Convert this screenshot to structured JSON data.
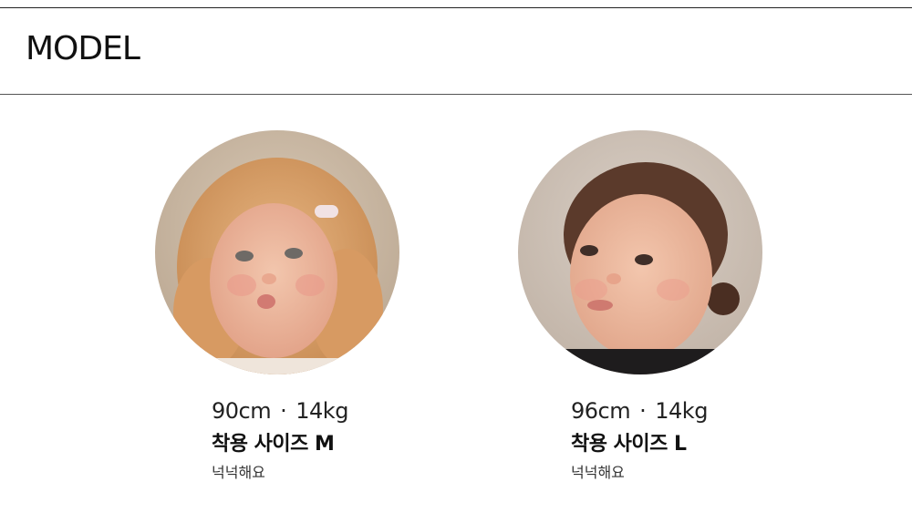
{
  "section": {
    "title": "MODEL"
  },
  "models": [
    {
      "height": "90cm",
      "weight": "14kg",
      "size_label": "착용 사이즈 M",
      "fit_note": "넉넉해요"
    },
    {
      "height": "96cm",
      "weight": "14kg",
      "size_label": "착용 사이즈 L",
      "fit_note": "넉넉해요"
    }
  ],
  "separator": "·",
  "colors": {
    "text": "#1a1a1a",
    "rule": "#555555",
    "background": "#ffffff"
  }
}
